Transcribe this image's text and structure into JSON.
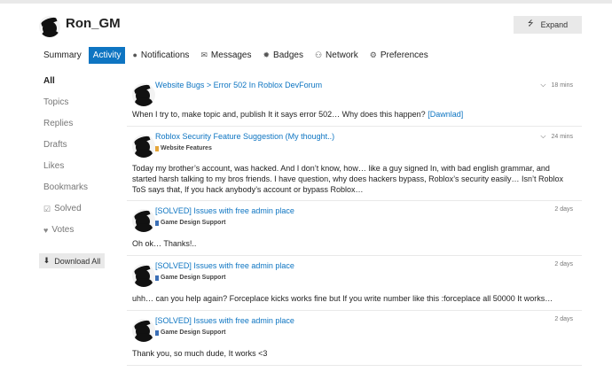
{
  "user": {
    "name": "Ron_GM"
  },
  "header": {
    "expand_label": "Expand",
    "expand_icon": "double-chevron"
  },
  "tabs": [
    {
      "label": "Summary",
      "icon": "",
      "active": false
    },
    {
      "label": "Activity",
      "icon": "",
      "active": true
    },
    {
      "label": "Notifications",
      "icon": "comment-icon",
      "active": false
    },
    {
      "label": "Messages",
      "icon": "envelope-icon",
      "active": false
    },
    {
      "label": "Badges",
      "icon": "badge-icon",
      "active": false
    },
    {
      "label": "Network",
      "icon": "users-icon",
      "active": false
    },
    {
      "label": "Preferences",
      "icon": "gear-icon",
      "active": false
    }
  ],
  "sidebar": {
    "items": [
      {
        "label": "All",
        "active": true
      },
      {
        "label": "Topics"
      },
      {
        "label": "Replies"
      },
      {
        "label": "Drafts"
      },
      {
        "label": "Likes"
      },
      {
        "label": "Bookmarks"
      },
      {
        "label": "Solved",
        "icon": "check-square-icon"
      },
      {
        "label": "Votes",
        "icon": "heart-icon"
      }
    ],
    "download_label": "Download All"
  },
  "posts": [
    {
      "title": "Website Bugs > Error 502 In Roblox DevForum",
      "category": "",
      "time": "18 mins",
      "excerpt": "When I try to, make topic and, publish It it says error 502… Why does this happen?",
      "excerpt_link": "[Dawnlad]"
    },
    {
      "title": "Roblox Security Feature Suggestion (My thought..)",
      "category": "Website Features",
      "category_color": "#e5a53a",
      "time": "24 mins",
      "excerpt": "Today my brother’s account, was hacked. And I don’t know, how… like a guy signed In, with bad english grammar, and started harsh talking to my bros friends. I have question, why does hackers bypass, Roblox’s security easily… Isn’t Roblox ToS says that, If you hack anybody’s account or bypass Roblox…"
    },
    {
      "title": "[SOLVED] Issues with free admin place",
      "category": "Game Design Support",
      "category_color": "#3b6fb6",
      "time": "2 days",
      "excerpt": "Oh ok… Thanks!.."
    },
    {
      "title": "[SOLVED] Issues with free admin place",
      "category": "Game Design Support",
      "category_color": "#3b6fb6",
      "time": "2 days",
      "excerpt": "uhh… can you help again? Forceplace kicks works fine but If you write number like this :forceplace all 50000 It works…"
    },
    {
      "title": "[SOLVED] Issues with free admin place",
      "category": "Game Design Support",
      "category_color": "#3b6fb6",
      "time": "2 days",
      "excerpt": "Thank you, so much dude, It works <3"
    }
  ]
}
